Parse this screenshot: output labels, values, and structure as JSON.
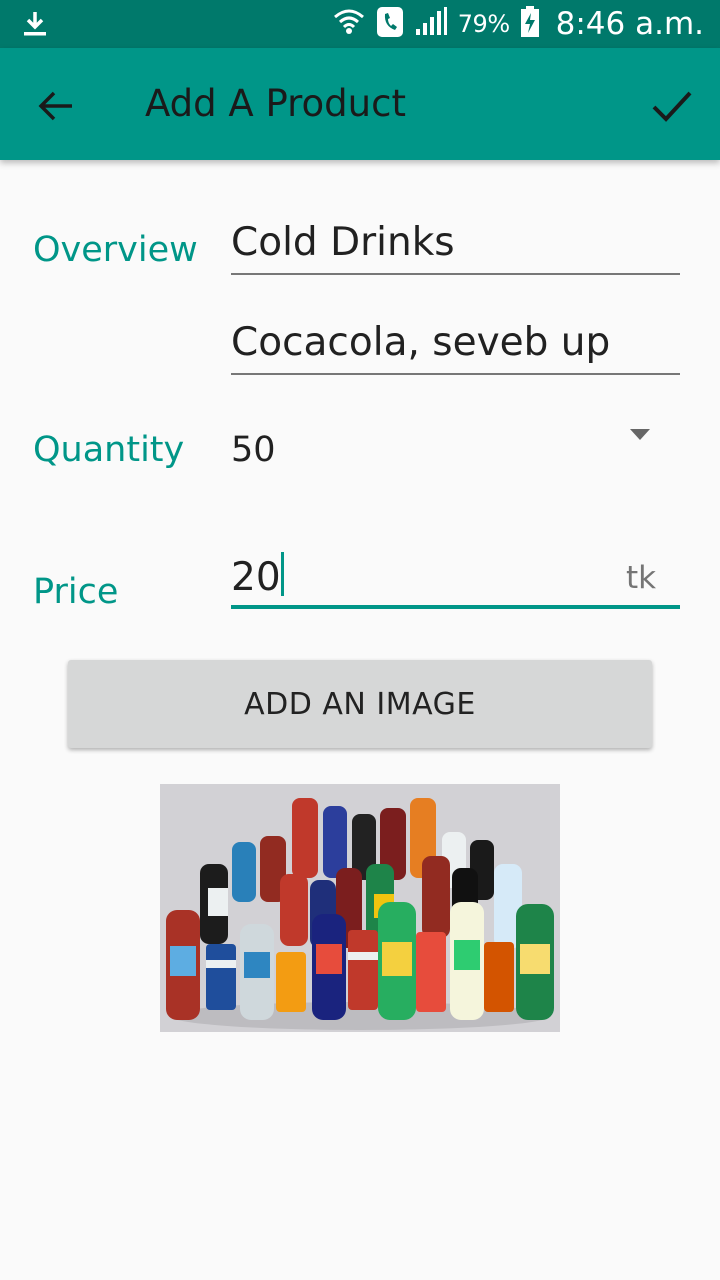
{
  "status_bar": {
    "battery": "79%",
    "time": "8:46 a.m.",
    "icons": [
      "download-icon",
      "wifi-icon",
      "call-icon",
      "signal-icon",
      "battery-charging-icon"
    ]
  },
  "app_bar": {
    "title": "Add A Product",
    "back_icon": "arrow-back-icon",
    "confirm_icon": "check-icon",
    "background": "#009688",
    "status_background": "#00796b"
  },
  "form": {
    "overview_label": "Overview",
    "name_value": "Cold Drinks",
    "description_value": "Cocacola, seveb up",
    "quantity_label": "Quantity",
    "quantity_value": "50",
    "price_label": "Price",
    "price_value": "20",
    "price_unit": "tk",
    "accent": "#009688"
  },
  "add_image_button": {
    "label": "ADD AN IMAGE"
  },
  "image": {
    "subject": "assorted soft drink bottles and cans"
  }
}
